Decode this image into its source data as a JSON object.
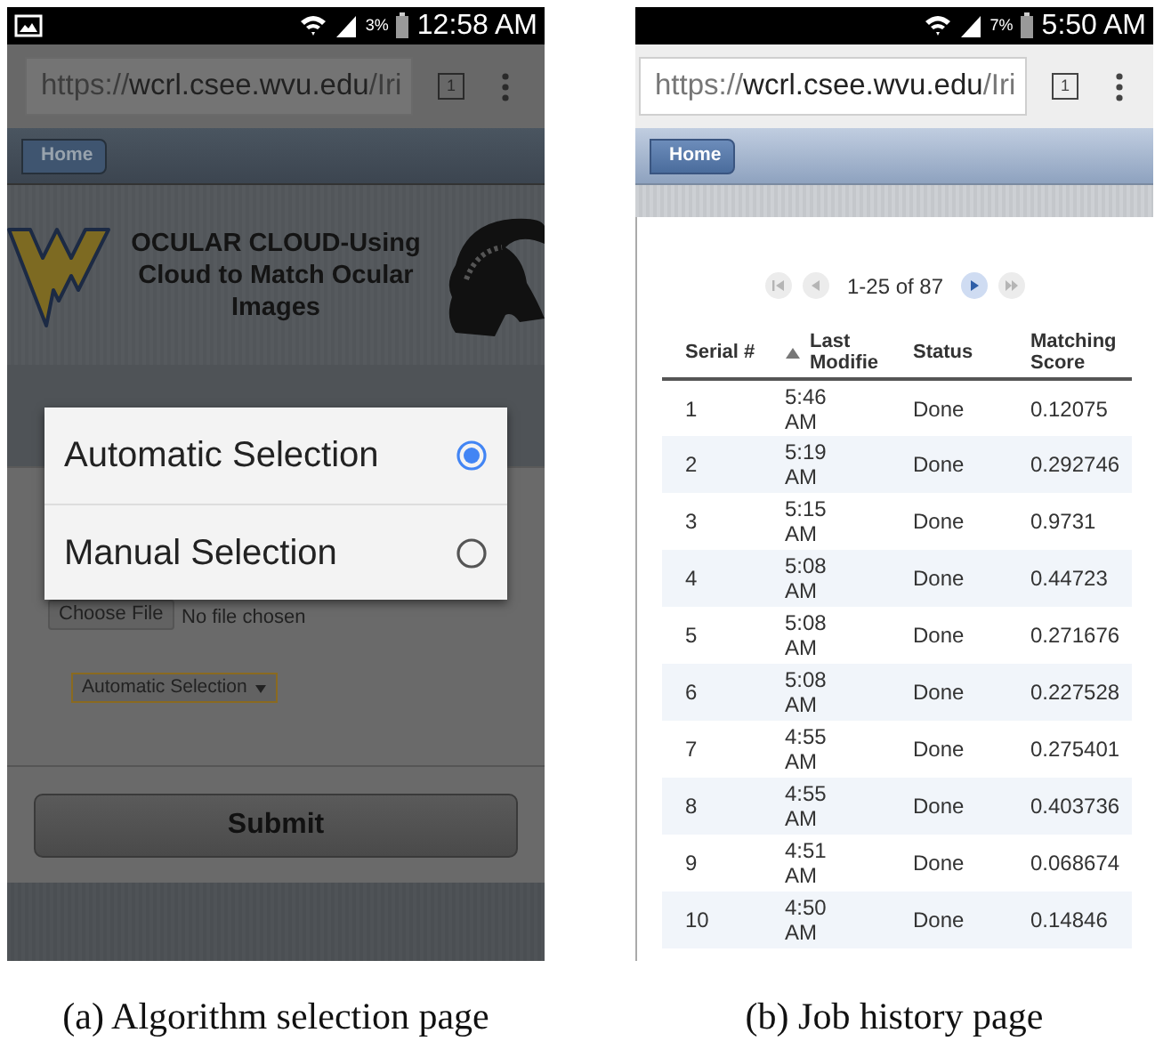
{
  "selection_page": {
    "status_bar": {
      "battery": "3%",
      "time": "12:58 AM"
    },
    "url": {
      "scheme": "https://",
      "host": "wcrl.csee.wvu.edu",
      "path": "/Iri"
    },
    "tab_count": "1",
    "home_button": "Home",
    "title": "OCULAR CLOUD-Using Cloud to Match Ocular Images",
    "file_button": "Choose File",
    "file_status": "No file chosen",
    "select_value": "Automatic Selection",
    "submit": "Submit",
    "dialog": {
      "options": [
        {
          "label": "Automatic Selection",
          "selected": true
        },
        {
          "label": "Manual Selection",
          "selected": false
        }
      ]
    },
    "caption": "(a) Algorithm selection page"
  },
  "history_page": {
    "status_bar": {
      "battery": "7%",
      "time": "5:50 AM"
    },
    "url": {
      "scheme": "https://",
      "host": "wcrl.csee.wvu.edu",
      "path": "/Iri"
    },
    "tab_count": "1",
    "home_button": "Home",
    "pager": {
      "range": "1-25 of 87",
      "buttons": [
        {
          "kind": "first",
          "disabled": true
        },
        {
          "kind": "prev",
          "disabled": true
        },
        {
          "kind": "next",
          "disabled": false
        },
        {
          "kind": "last",
          "disabled": true
        }
      ]
    },
    "table": {
      "columns": [
        {
          "label": "Serial #",
          "sorted": false
        },
        {
          "label": "Last Modifie",
          "sorted": true
        },
        {
          "label": "Status",
          "sorted": false
        },
        {
          "label": "Matching Score",
          "sorted": false
        }
      ],
      "rows": [
        [
          "1",
          "5:46 AM",
          "Done",
          "0.12075"
        ],
        [
          "2",
          "5:19 AM",
          "Done",
          "0.292746"
        ],
        [
          "3",
          "5:15 AM",
          "Done",
          "0.9731"
        ],
        [
          "4",
          "5:08 AM",
          "Done",
          "0.44723"
        ],
        [
          "5",
          "5:08 AM",
          "Done",
          "0.271676"
        ],
        [
          "6",
          "5:08 AM",
          "Done",
          "0.227528"
        ],
        [
          "7",
          "4:55 AM",
          "Done",
          "0.275401"
        ],
        [
          "8",
          "4:55 AM",
          "Done",
          "0.403736"
        ],
        [
          "9",
          "4:51 AM",
          "Done",
          "0.068674"
        ],
        [
          "10",
          "4:50 AM",
          "Done",
          "0.14846"
        ]
      ]
    },
    "caption": "(b) Job history page"
  }
}
